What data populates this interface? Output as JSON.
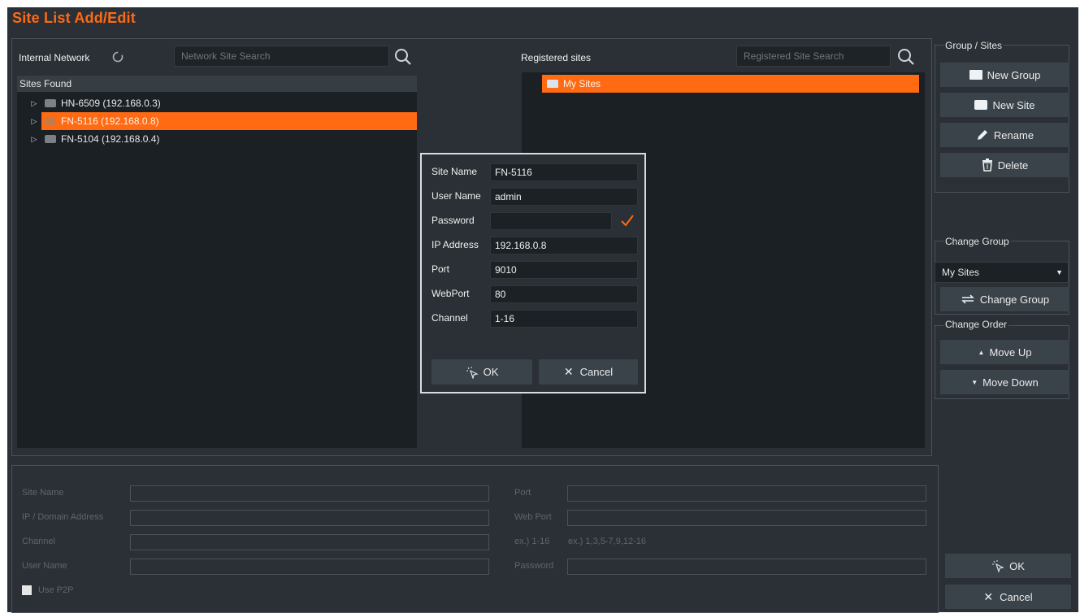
{
  "window": {
    "title": "Site List Add/Edit"
  },
  "internal_network": {
    "label": "Internal Network",
    "search_placeholder": "Network Site Search",
    "list_header": "Sites Found",
    "sites": [
      {
        "label": "HN-6509 (192.168.0.3)",
        "selected": false
      },
      {
        "label": "FN-5116 (192.168.0.8)",
        "selected": true
      },
      {
        "label": "FN-5104 (192.168.0.4)",
        "selected": false
      }
    ]
  },
  "registered": {
    "label": "Registered sites",
    "search_placeholder": "Registered Site Search",
    "groups": [
      {
        "label": "My Sites",
        "selected": true
      }
    ]
  },
  "dialog": {
    "site_name_label": "Site Name",
    "site_name_value": "FN-5116",
    "user_name_label": "User Name",
    "user_name_value": "admin",
    "password_label": "Password",
    "password_value": "",
    "ip_label": "IP Address",
    "ip_value": "192.168.0.8",
    "port_label": "Port",
    "port_value": "9010",
    "webport_label": "WebPort",
    "webport_value": "80",
    "channel_label": "Channel",
    "channel_value": "1-16",
    "ok_label": "OK",
    "cancel_label": "Cancel"
  },
  "form": {
    "site_name_label": "Site Name",
    "ip_label": "IP / Domain Address",
    "channel_label": "Channel",
    "user_name_label": "User Name",
    "use_p2p_label": "Use P2P",
    "port_label": "Port",
    "web_port_label": "Web Port",
    "channel_hint_1": "ex.) 1-16",
    "channel_hint_2": "ex.) 1,3,5-7,9,12-16",
    "password_label": "Password"
  },
  "group_sites": {
    "legend": "Group / Sites",
    "new_group": "New Group",
    "new_site": "New Site",
    "rename": "Rename",
    "delete": "Delete"
  },
  "change_group": {
    "legend": "Change Group",
    "selected_group": "My Sites",
    "button": "Change Group"
  },
  "change_order": {
    "legend": "Change Order",
    "move_up": "Move Up",
    "move_down": "Move Down"
  },
  "footer": {
    "ok_label": "OK",
    "cancel_label": "Cancel"
  },
  "colors": {
    "accent": "#ff6a13",
    "window_bg": "#2a3035",
    "panel_bg": "#1b2024"
  },
  "icons": [
    "refresh-icon",
    "search-icon",
    "expand-arrow-icon",
    "device-icon",
    "folder-icon",
    "pencil-icon",
    "trash-icon",
    "swap-icon",
    "checkmark-icon",
    "ok-cursor-icon",
    "close-icon"
  ]
}
